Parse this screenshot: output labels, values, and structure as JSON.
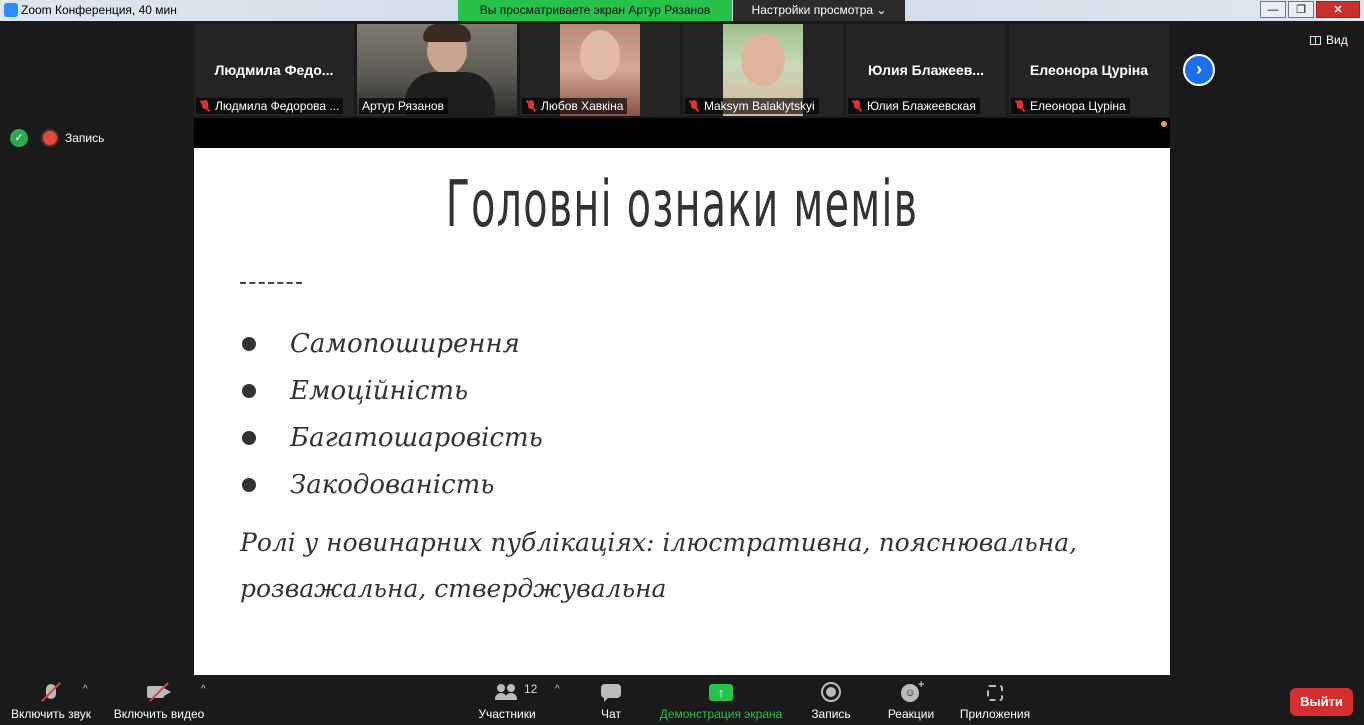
{
  "window": {
    "title": "Zoom Конференция, 40 мин",
    "share_banner": "Вы просматриваете экран Артур Рязанов",
    "view_settings": "Настройки просмотра",
    "controls": [
      "—",
      "❐",
      "✕"
    ]
  },
  "gallery": {
    "tiles": [
      {
        "big_name": "Людмила  Федо...",
        "label": "Людмила Федорова ...",
        "muted": true
      },
      {
        "big_name": "",
        "label": "Артур Рязанов",
        "muted": false,
        "active": true
      },
      {
        "big_name": "",
        "label": "Любов Хавкіна",
        "muted": true
      },
      {
        "big_name": "",
        "label": "Maksym Balaklytskyi",
        "muted": true
      },
      {
        "big_name": "Юлия  Блажеев...",
        "label": "Юлия Блажеевская",
        "muted": true
      },
      {
        "big_name": "Елеонора Цуріна",
        "label": "Елеонора Цуріна",
        "muted": true
      }
    ],
    "next_icon": "chevron-right-icon",
    "view_label": "Вид"
  },
  "status": {
    "recording_label": "Запись"
  },
  "slide": {
    "title": "Головні ознаки мемів",
    "bullets": [
      "Самопоширення",
      "Емоційність",
      "Багатошаровість",
      "Закодованість"
    ],
    "roles": "Ролі у новинарних публікаціях: ілюстративна, пояснювальна, розважальна, стверджувальна"
  },
  "toolbar": {
    "audio": "Включить звук",
    "video": "Включить видео",
    "participants": "Участники",
    "participants_count": "12",
    "chat": "Чат",
    "share": "Демонстрация экрана",
    "record": "Запись",
    "reactions": "Реакции",
    "apps": "Приложения",
    "leave": "Выйти"
  },
  "colors": {
    "share_green": "#27c24c",
    "leave_red": "#d32f2f",
    "accent_blue": "#1b6fe8"
  }
}
